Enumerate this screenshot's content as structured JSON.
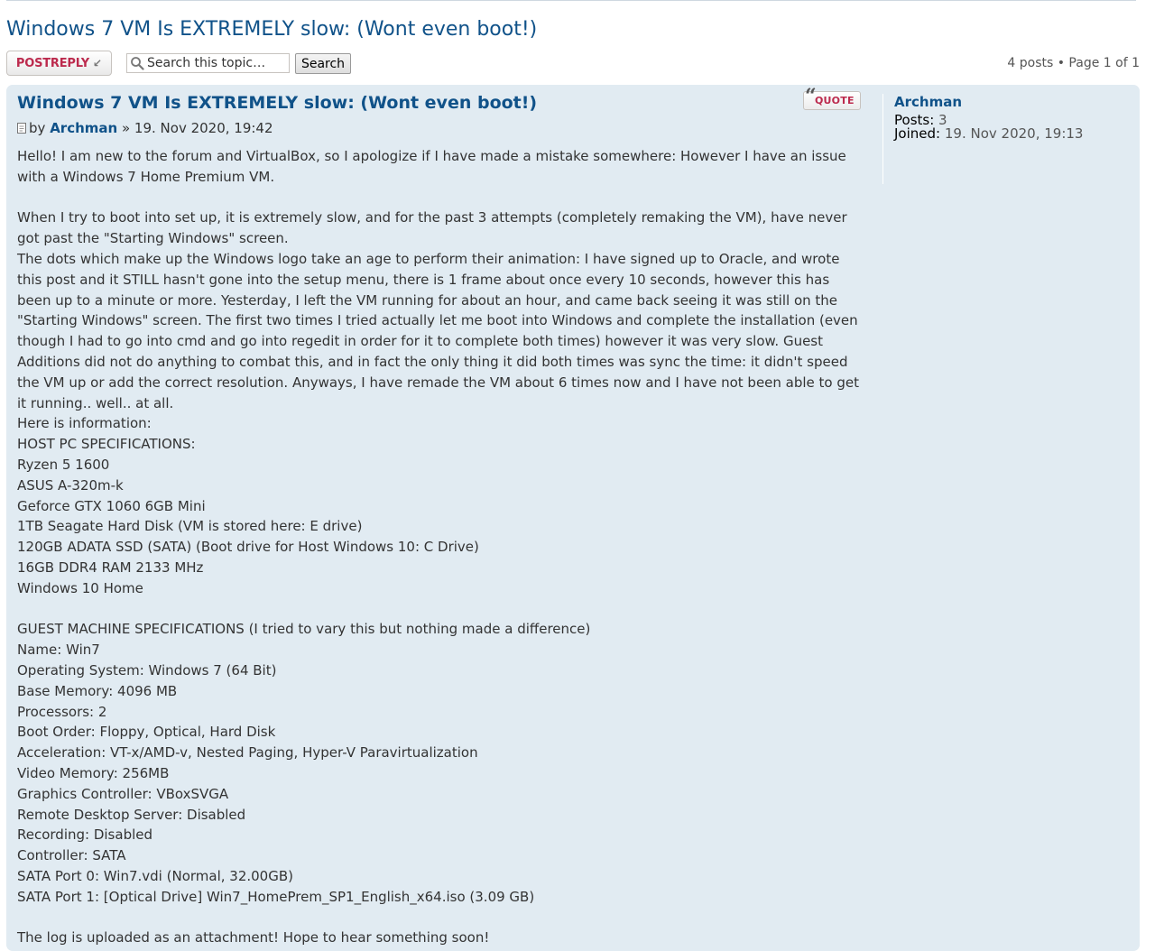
{
  "topic": {
    "title": "Windows 7 VM Is EXTREMELY slow: (Wont even boot!)"
  },
  "action_bar": {
    "post_reply_label": "POSTREPLY",
    "search_placeholder": "Search this topic…",
    "search_button_label": "Search",
    "pagination_text": "4 posts • Page 1 of 1"
  },
  "post": {
    "title": "Windows 7 VM Is EXTREMELY slow: (Wont even boot!)",
    "quote_label": "QUOTE",
    "by_label": "by",
    "author": "Archman",
    "date_separator": " » 19. Nov 2020, 19:42",
    "paragraphs": [
      "Hello! I am new to the forum and VirtualBox, so I apologize if I have made a mistake somewhere: However I have an issue with a Windows 7 Home Premium VM.",
      "",
      "When I try to boot into set up, it is extremely slow, and for the past 3 attempts (completely remaking the VM), have never got past the \"Starting Windows\" screen.",
      "The dots which make up the Windows logo take an age to perform their animation: I have signed up to Oracle, and wrote this post and it STILL hasn't gone into the setup menu, there is 1 frame about once every 10 seconds, however this has been up to a minute or more. Yesterday, I left the VM running for about an hour, and came back seeing it was still on the \"Starting Windows\" screen. The first two times I tried actually let me boot into Windows and complete the installation (even though I had to go into cmd and go into regedit in order for it to complete both times) however it was very slow. Guest Additions did not do anything to combat this, and in fact the only thing it did both times was sync the time: it didn't speed the VM up or add the correct resolution. Anyways, I have remade the VM about 6 times now and I have not been able to get it running.. well.. at all.",
      "Here is information:",
      "HOST PC SPECIFICATIONS:",
      "Ryzen 5 1600",
      "ASUS A-320m-k",
      "Geforce GTX 1060 6GB Mini",
      "1TB Seagate Hard Disk (VM is stored here: E drive)",
      "120GB ADATA SSD (SATA) (Boot drive for Host Windows 10: C Drive)",
      "16GB DDR4 RAM 2133 MHz",
      "Windows 10 Home",
      "",
      "GUEST MACHINE SPECIFICATIONS (I tried to vary this but nothing made a difference)",
      "Name: Win7",
      "Operating System: Windows 7 (64 Bit)",
      "Base Memory: 4096 MB",
      "Processors: 2",
      "Boot Order: Floppy, Optical, Hard Disk",
      "Acceleration: VT-x/AMD-v, Nested Paging, Hyper-V Paravirtualization",
      "Video Memory: 256MB",
      "Graphics Controller: VBoxSVGA",
      "Remote Desktop Server: Disabled",
      "Recording: Disabled",
      "Controller: SATA",
      "SATA Port 0: Win7.vdi (Normal, 32.00GB)",
      "SATA Port 1: [Optical Drive] Win7_HomePrem_SP1_English_x64.iso (3.09 GB)",
      "",
      "The log is uploaded as an attachment! Hope to hear something soon!"
    ]
  },
  "profile": {
    "username": "Archman",
    "posts_label": "Posts:",
    "posts_value": "3",
    "joined_label": "Joined:",
    "joined_value": "19. Nov 2020, 19:13"
  },
  "colors": {
    "link": "#105289",
    "button_text": "#bc2a4d",
    "post_bg": "#e1ebf2"
  }
}
